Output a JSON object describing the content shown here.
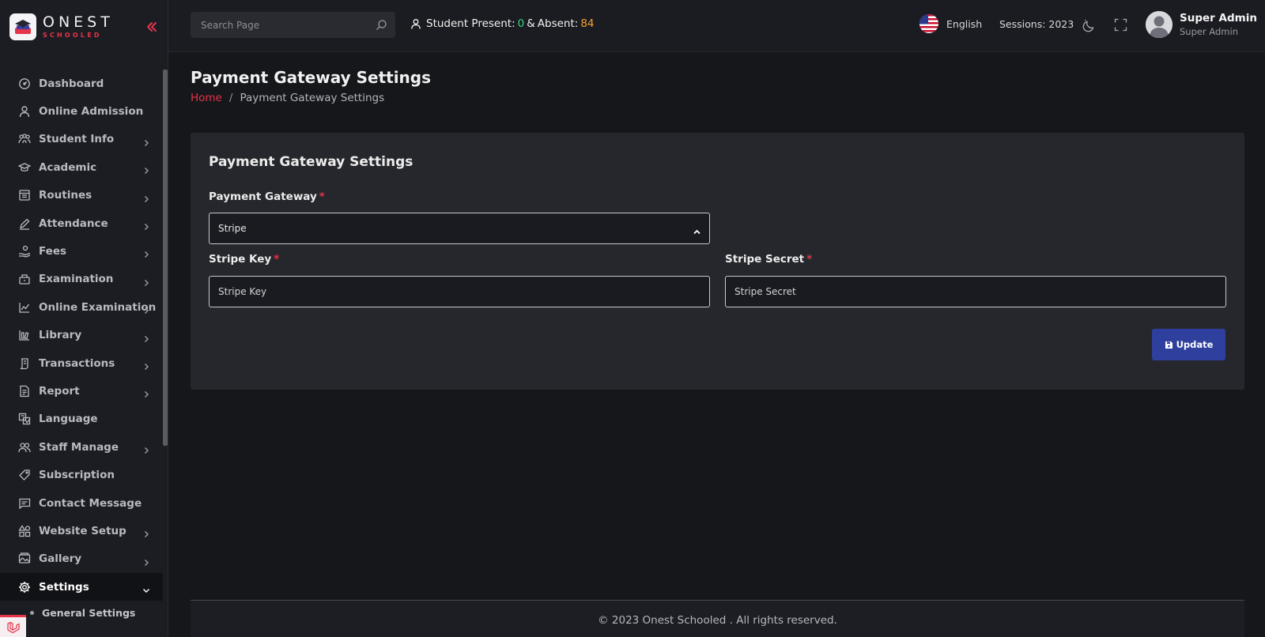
{
  "brand": {
    "name": "ONEST",
    "sub": "SCHOOLED"
  },
  "sidebar": {
    "items": [
      {
        "label": "Dashboard",
        "icon": "dashboard-icon",
        "has_children": false
      },
      {
        "label": "Online Admission",
        "icon": "user-icon",
        "has_children": false
      },
      {
        "label": "Student Info",
        "icon": "students-icon",
        "has_children": true
      },
      {
        "label": "Academic",
        "icon": "graduation-cap-icon",
        "has_children": true
      },
      {
        "label": "Routines",
        "icon": "calendar-icon",
        "has_children": true
      },
      {
        "label": "Attendance",
        "icon": "pen-icon",
        "has_children": true
      },
      {
        "label": "Fees",
        "icon": "money-hand-icon",
        "has_children": true
      },
      {
        "label": "Examination",
        "icon": "exam-icon",
        "has_children": true
      },
      {
        "label": "Online Examination",
        "icon": "chart-icon",
        "has_children": true
      },
      {
        "label": "Library",
        "icon": "books-icon",
        "has_children": true
      },
      {
        "label": "Transactions",
        "icon": "scroll-icon",
        "has_children": true
      },
      {
        "label": "Report",
        "icon": "report-icon",
        "has_children": true
      },
      {
        "label": "Language",
        "icon": "language-icon",
        "has_children": false
      },
      {
        "label": "Staff Manage",
        "icon": "staff-icon",
        "has_children": true
      },
      {
        "label": "Subscription",
        "icon": "tag-icon",
        "has_children": false
      },
      {
        "label": "Contact Message",
        "icon": "message-icon",
        "has_children": false
      },
      {
        "label": "Website Setup",
        "icon": "shapes-icon",
        "has_children": true
      },
      {
        "label": "Gallery",
        "icon": "gallery-icon",
        "has_children": true
      },
      {
        "label": "Settings",
        "icon": "gear-icon",
        "has_children": true,
        "active": true
      }
    ],
    "sub_items": [
      {
        "label": "General Settings"
      }
    ]
  },
  "topbar": {
    "search_placeholder": "Search Page",
    "attendance": {
      "present_label": "Student Present:",
      "present": "0",
      "and_label": "&",
      "absent_label": "Absent:",
      "absent": "84"
    },
    "language": "English",
    "sessions": "Sessions: 2023",
    "user": {
      "name": "Super Admin",
      "role": "Super Admin"
    }
  },
  "page": {
    "title": "Payment Gateway Settings",
    "breadcrumb": {
      "home": "Home",
      "separator": "/",
      "current": "Payment Gateway Settings"
    }
  },
  "form": {
    "title": "Payment Gateway Settings",
    "gateway_label": "Payment Gateway",
    "gateway_value": "Stripe",
    "key_label": "Stripe Key",
    "key_placeholder": "Stripe Key",
    "secret_label": "Stripe Secret",
    "secret_placeholder": "Stripe Secret",
    "required_mark": "*",
    "update_label": "Update"
  },
  "footer": {
    "text": "© 2023 Onest Schooled . All rights reserved."
  },
  "colors": {
    "accent_red": "#e5334a",
    "button_blue": "#2f3f9e",
    "present_green": "#2fd67a",
    "absent_orange": "#f4a12a"
  }
}
